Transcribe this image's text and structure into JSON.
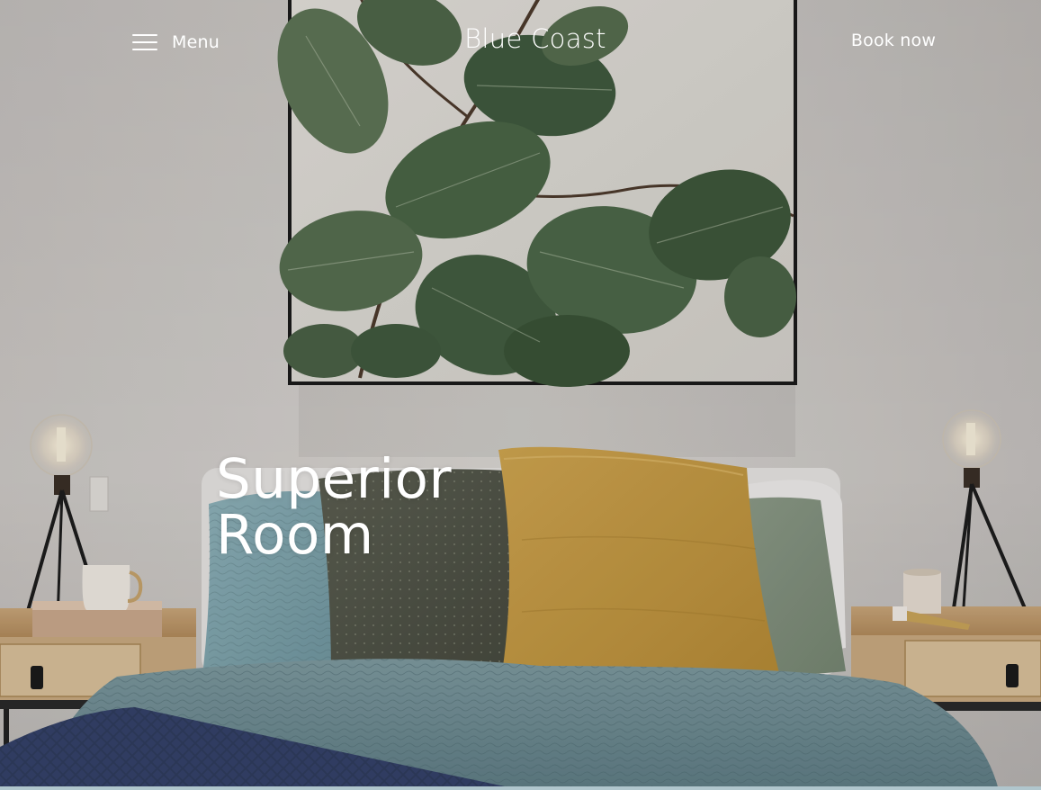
{
  "header": {
    "menu_label": "Menu",
    "brand": "Blue Coast",
    "book_label": "Book now"
  },
  "hero": {
    "title_line1": "Superior",
    "title_line2": "Room"
  },
  "icons": {
    "menu": "hamburger-icon"
  },
  "colors": {
    "header_text": "#ffffff",
    "wall": "#d6d3cf"
  }
}
